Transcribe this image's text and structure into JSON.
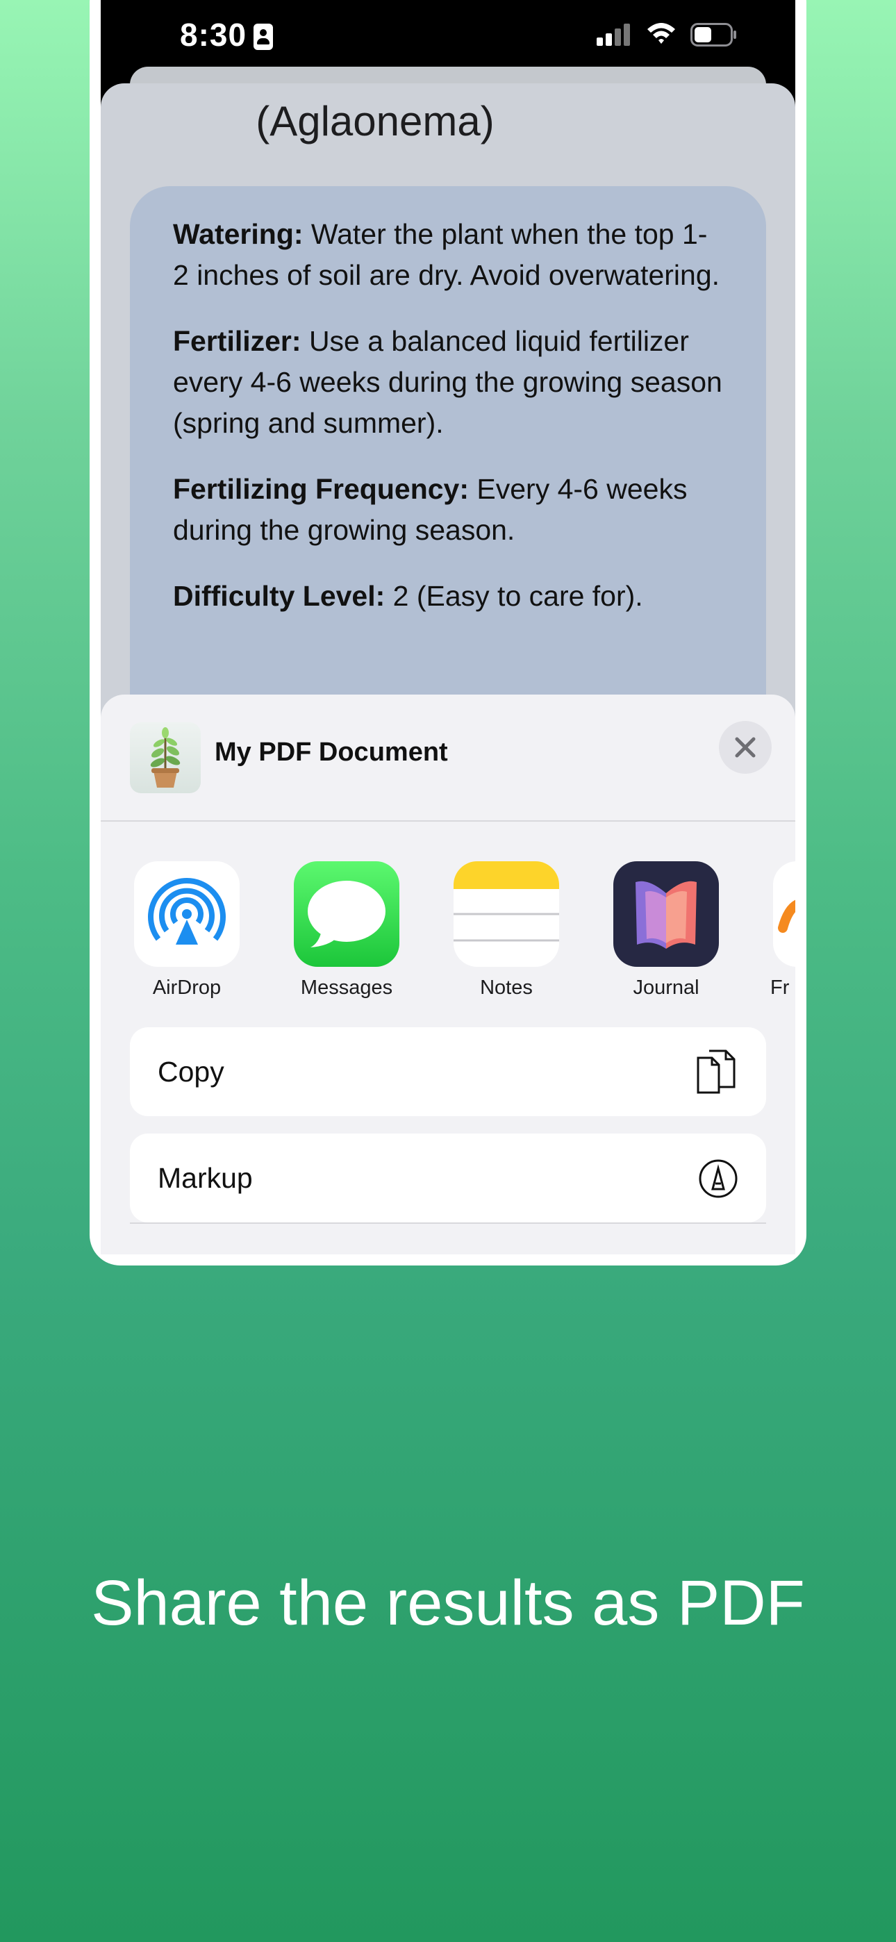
{
  "status_bar": {
    "time": "8:30"
  },
  "document": {
    "title": "(Aglaonema)",
    "items": [
      {
        "label": "Watering:",
        "text": " Water the plant when the top 1-2 inches of soil are dry. Avoid overwatering."
      },
      {
        "label": "Fertilizer:",
        "text": " Use a balanced liquid fertilizer every 4-6 weeks during the growing season (spring and summer)."
      },
      {
        "label": "Fertilizing Frequency:",
        "text": " Every 4-6 weeks during the growing season."
      },
      {
        "label": "Difficulty Level:",
        "text": " 2 (Easy to care for)."
      }
    ]
  },
  "share_sheet": {
    "title": "My PDF Document",
    "apps": [
      {
        "label": "AirDrop",
        "icon": "airdrop-icon"
      },
      {
        "label": "Messages",
        "icon": "messages-icon"
      },
      {
        "label": "Notes",
        "icon": "notes-icon"
      },
      {
        "label": "Journal",
        "icon": "journal-icon"
      },
      {
        "label": "Fr",
        "icon": "freeform-icon"
      }
    ],
    "actions": [
      {
        "label": "Copy",
        "icon": "copy-icon"
      },
      {
        "label": "Markup",
        "icon": "markup-icon"
      }
    ]
  },
  "caption": "Share the results as PDF",
  "colors": {
    "background_top": "#98f5b4",
    "background_bottom": "#22985e",
    "info_panel": "#b2bfd3",
    "sheet": "#f2f2f5"
  }
}
